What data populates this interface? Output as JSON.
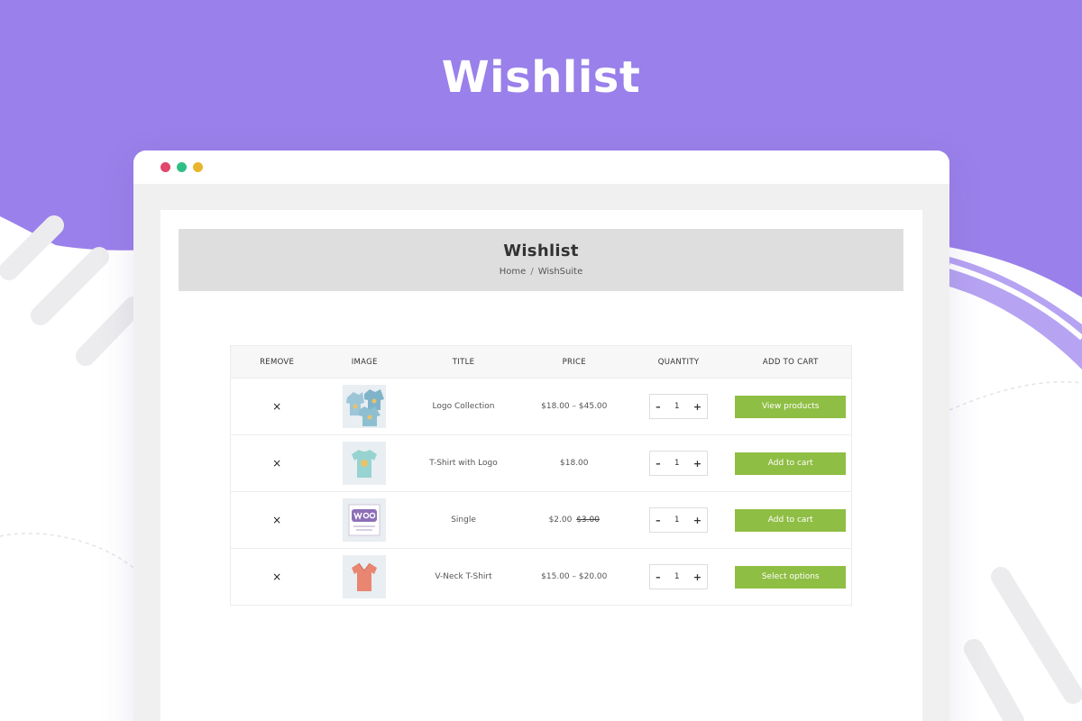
{
  "banner": {
    "title": "Wishlist"
  },
  "colors": {
    "banner": "#9a80ea",
    "button": "#8fbe44",
    "dot_red": "#e1466b",
    "dot_green": "#2fbf86",
    "dot_yellow": "#e7b62f"
  },
  "page": {
    "title": "Wishlist",
    "breadcrumb": {
      "home": "Home",
      "separator": "/",
      "current": "WishSuite"
    }
  },
  "table": {
    "headers": {
      "remove": "REMOVE",
      "image": "IMAGE",
      "title": "TITLE",
      "price": "PRICE",
      "quantity": "QUANTITY",
      "add_to_cart": "ADD TO CART"
    },
    "rows": [
      {
        "remove": "×",
        "image_icon": "hoodies-bundle-icon",
        "title": "Logo Collection",
        "price": "$18.00 – $45.00",
        "old_price": "",
        "qty_minus": "–",
        "qty": "1",
        "qty_plus": "+",
        "button": "View products"
      },
      {
        "remove": "×",
        "image_icon": "tshirt-icon",
        "title": "T-Shirt with Logo",
        "price": "$18.00",
        "old_price": "",
        "qty_minus": "–",
        "qty": "1",
        "qty_plus": "+",
        "button": "Add to cart"
      },
      {
        "remove": "×",
        "image_icon": "album-woo-icon",
        "title": "Single",
        "price": "$2.00",
        "old_price": "$3.00",
        "qty_minus": "–",
        "qty": "1",
        "qty_plus": "+",
        "button": "Add to cart"
      },
      {
        "remove": "×",
        "image_icon": "vneck-tshirt-icon",
        "title": "V-Neck T-Shirt",
        "price": "$15.00 – $20.00",
        "old_price": "",
        "qty_minus": "–",
        "qty": "1",
        "qty_plus": "+",
        "button": "Select options"
      }
    ]
  }
}
